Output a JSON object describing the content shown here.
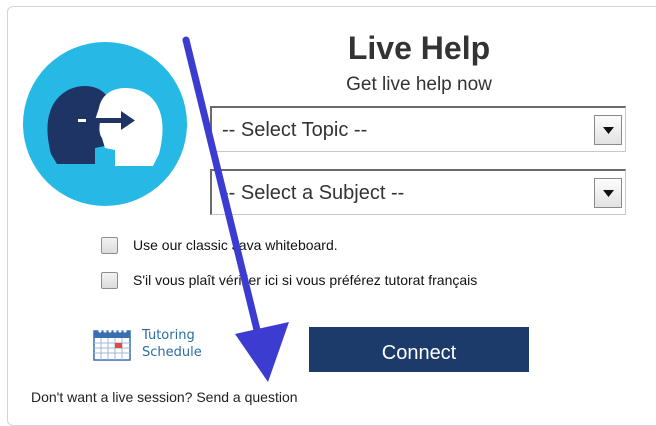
{
  "header": {
    "title": "Live Help",
    "subtitle": "Get live help now"
  },
  "logo": {
    "icon": "two-heads-exchange-icon",
    "circle_color": "#27b9e6",
    "dark_head_color": "#1d3464"
  },
  "topic_select": {
    "selected": "-- Select Topic --"
  },
  "subject_select": {
    "selected": "-- Select a Subject --"
  },
  "options": {
    "java_whiteboard": "Use our classic Java whiteboard.",
    "french_tutoring": "S'il vous plaît vérifier ici si vous préférez tutorat français"
  },
  "tutoring_schedule": {
    "icon": "calendar-icon",
    "label_line1": "Tutoring",
    "label_line2": "Schedule",
    "color": "#2a6ea5"
  },
  "connect": {
    "label": "Connect",
    "color": "#1c3b6a"
  },
  "footer": {
    "prompt": "Don't want a live session?",
    "link": "Send a question"
  },
  "annotation": {
    "icon": "pointer-arrow-icon",
    "color": "#3c3cd0"
  }
}
